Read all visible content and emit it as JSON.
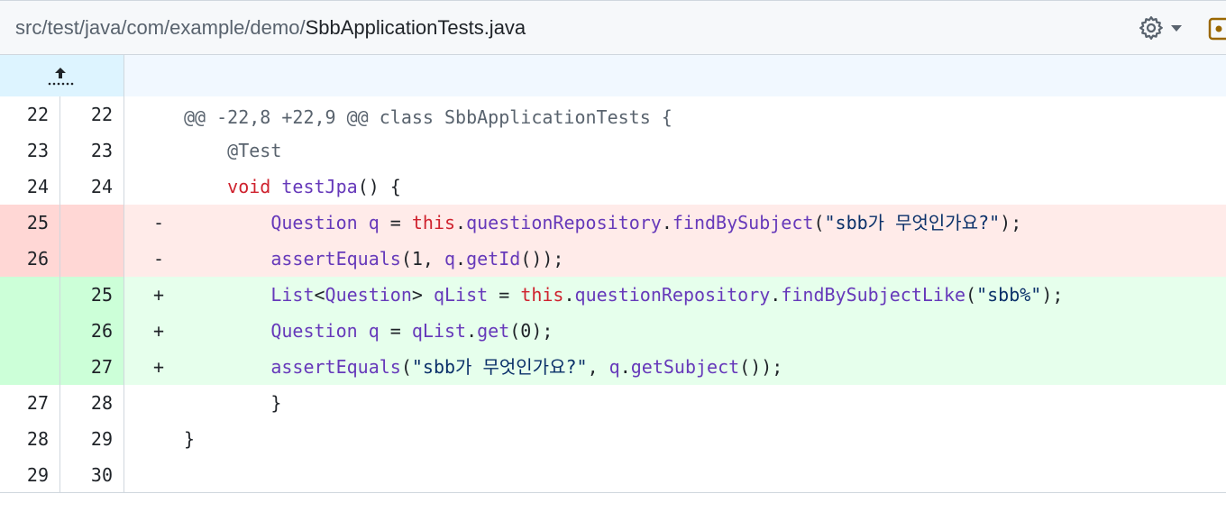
{
  "file": {
    "dir": "src/test/java/com/example/demo/",
    "name": "SbbApplicationTests.java"
  },
  "hunk_header": "@@ -22,8 +22,9 @@ class SbbApplicationTests {",
  "rows": [
    {
      "type": "ctx",
      "old": "22",
      "new": "22",
      "marker": "",
      "tokens": []
    },
    {
      "type": "ctx",
      "old": "23",
      "new": "23",
      "marker": "",
      "tokens": [
        {
          "t": "    ",
          "c": ""
        },
        {
          "t": "@Test",
          "c": "ann"
        }
      ]
    },
    {
      "type": "ctx",
      "old": "24",
      "new": "24",
      "marker": "",
      "tokens": [
        {
          "t": "    ",
          "c": ""
        },
        {
          "t": "void",
          "c": "kw"
        },
        {
          "t": " ",
          "c": ""
        },
        {
          "t": "testJpa",
          "c": "fn"
        },
        {
          "t": "() {",
          "c": ""
        }
      ]
    },
    {
      "type": "del",
      "old": "25",
      "new": "",
      "marker": "-",
      "tokens": [
        {
          "t": "        ",
          "c": ""
        },
        {
          "t": "Question",
          "c": "type"
        },
        {
          "t": " ",
          "c": ""
        },
        {
          "t": "q",
          "c": "type"
        },
        {
          "t": " = ",
          "c": ""
        },
        {
          "t": "this",
          "c": "kw"
        },
        {
          "t": ".",
          "c": ""
        },
        {
          "t": "questionRepository",
          "c": "fn"
        },
        {
          "t": ".",
          "c": ""
        },
        {
          "t": "findBySubject",
          "c": "fn"
        },
        {
          "t": "(",
          "c": ""
        },
        {
          "t": "\"sbb가 무엇인가요?\"",
          "c": "str"
        },
        {
          "t": ");",
          "c": ""
        }
      ]
    },
    {
      "type": "del",
      "old": "26",
      "new": "",
      "marker": "-",
      "tokens": [
        {
          "t": "        ",
          "c": ""
        },
        {
          "t": "assertEquals",
          "c": "fn"
        },
        {
          "t": "(1, ",
          "c": ""
        },
        {
          "t": "q",
          "c": "type"
        },
        {
          "t": ".",
          "c": ""
        },
        {
          "t": "getId",
          "c": "fn"
        },
        {
          "t": "());",
          "c": ""
        }
      ]
    },
    {
      "type": "add",
      "old": "",
      "new": "25",
      "marker": "+",
      "tokens": [
        {
          "t": "        ",
          "c": ""
        },
        {
          "t": "List",
          "c": "type"
        },
        {
          "t": "<",
          "c": ""
        },
        {
          "t": "Question",
          "c": "type"
        },
        {
          "t": "> ",
          "c": ""
        },
        {
          "t": "qList",
          "c": "type"
        },
        {
          "t": " = ",
          "c": ""
        },
        {
          "t": "this",
          "c": "kw"
        },
        {
          "t": ".",
          "c": ""
        },
        {
          "t": "questionRepository",
          "c": "fn"
        },
        {
          "t": ".",
          "c": ""
        },
        {
          "t": "findBySubjectLike",
          "c": "fn"
        },
        {
          "t": "(",
          "c": ""
        },
        {
          "t": "\"sbb%\"",
          "c": "str"
        },
        {
          "t": ");",
          "c": ""
        }
      ]
    },
    {
      "type": "add",
      "old": "",
      "new": "26",
      "marker": "+",
      "tokens": [
        {
          "t": "        ",
          "c": ""
        },
        {
          "t": "Question",
          "c": "type"
        },
        {
          "t": " ",
          "c": ""
        },
        {
          "t": "q",
          "c": "type"
        },
        {
          "t": " = ",
          "c": ""
        },
        {
          "t": "qList",
          "c": "type"
        },
        {
          "t": ".",
          "c": ""
        },
        {
          "t": "get",
          "c": "fn"
        },
        {
          "t": "(0);",
          "c": ""
        }
      ]
    },
    {
      "type": "add",
      "old": "",
      "new": "27",
      "marker": "+",
      "tokens": [
        {
          "t": "        ",
          "c": ""
        },
        {
          "t": "assertEquals",
          "c": "fn"
        },
        {
          "t": "(",
          "c": ""
        },
        {
          "t": "\"sbb가 무엇인가요?\"",
          "c": "str"
        },
        {
          "t": ", ",
          "c": ""
        },
        {
          "t": "q",
          "c": "type"
        },
        {
          "t": ".",
          "c": ""
        },
        {
          "t": "getSubject",
          "c": "fn"
        },
        {
          "t": "());",
          "c": ""
        }
      ]
    },
    {
      "type": "ctx",
      "old": "27",
      "new": "28",
      "marker": "",
      "tokens": [
        {
          "t": "        }",
          "c": ""
        }
      ]
    },
    {
      "type": "ctx",
      "old": "28",
      "new": "29",
      "marker": "",
      "tokens": [
        {
          "t": "}",
          "c": ""
        }
      ]
    },
    {
      "type": "ctx",
      "old": "29",
      "new": "30",
      "marker": "",
      "tokens": []
    }
  ],
  "icons": {
    "settings": "gear-icon",
    "dropdown": "triangle-down-icon",
    "expand": "expand-up-icon",
    "view": "file-view-icon"
  },
  "colors": {
    "del_num_bg": "#ffd7d5",
    "del_code_bg": "#ffebe9",
    "add_num_bg": "#ccffd8",
    "add_code_bg": "#e6ffec",
    "hunk_bg": "#f1f8ff",
    "expander_bg": "#ddf4ff"
  }
}
